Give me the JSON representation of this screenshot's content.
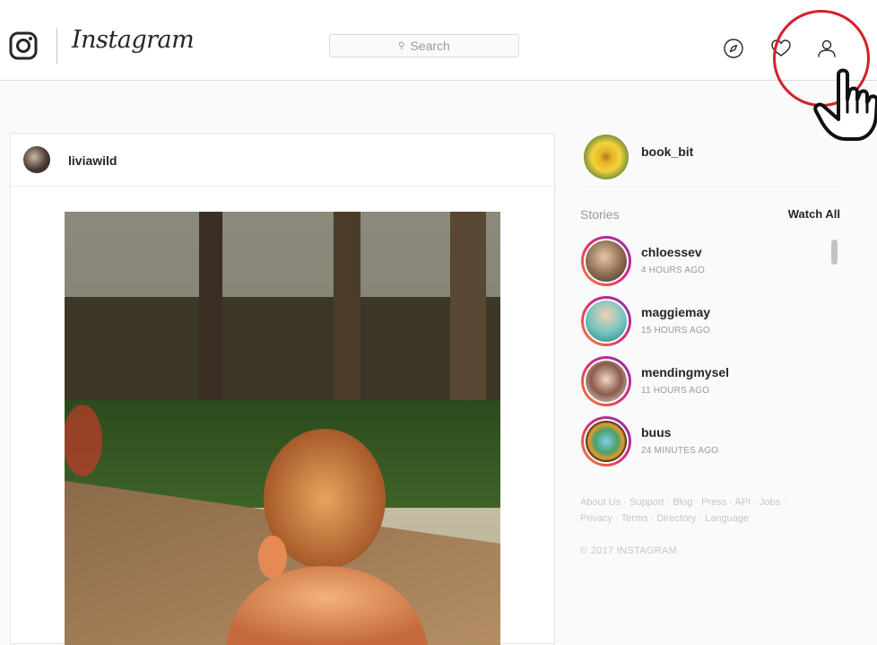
{
  "app": {
    "name": "Instagram",
    "search_placeholder": "Search"
  },
  "icons": {
    "logo": "instagram-camera-icon",
    "search": "search-icon",
    "explore": "compass-icon",
    "activity": "heart-icon",
    "profile": "profile-icon",
    "cursor": "hand-pointer-icon"
  },
  "post": {
    "username": "liviawild"
  },
  "sidebar": {
    "current_user": "book_bit",
    "stories_title": "Stories",
    "watch_all": "Watch All",
    "stories": [
      {
        "name": "chloessev",
        "time": "4 HOURS AGO"
      },
      {
        "name": "maggiemay",
        "time": "15 HOURS AGO"
      },
      {
        "name": "mendingmysel",
        "time": "11 HOURS AGO"
      },
      {
        "name": "buus",
        "time": "24 MINUTES AGO"
      }
    ],
    "footer_links_1": "About Us · Support · Blog · Press · API · Jobs ·",
    "footer_links_2": "Privacy · Terms · Directory · Language",
    "copyright": "© 2017 INSTAGRAM"
  },
  "colors": {
    "highlight_ring": "#d4202a",
    "story_gradient_start": "#f58529",
    "story_gradient_end": "#8134af"
  }
}
